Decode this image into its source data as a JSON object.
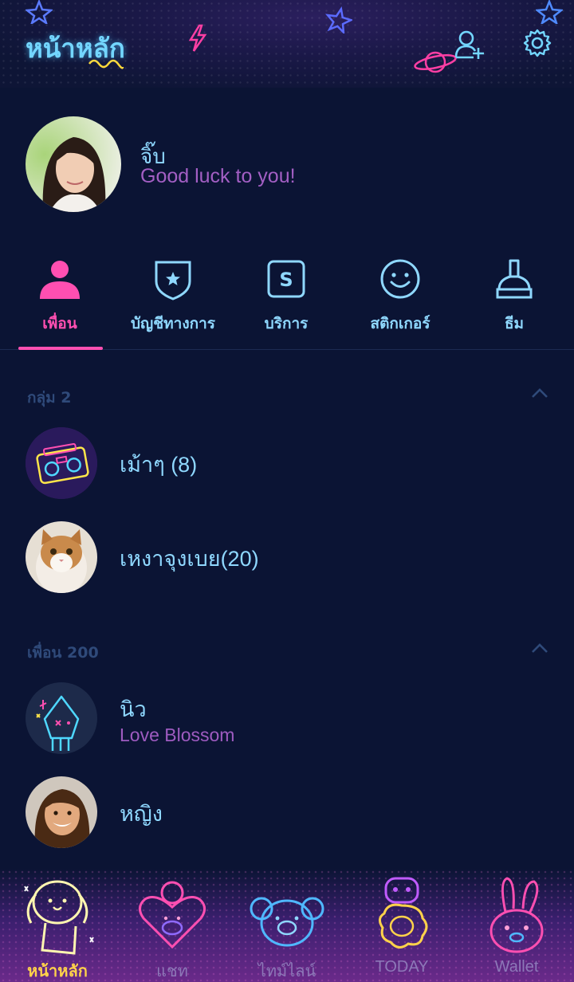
{
  "header": {
    "title": "หน้าหลัก"
  },
  "profile": {
    "name": "จิ๊บ",
    "status": "Good luck to you!"
  },
  "tabs": [
    {
      "label": "เพื่อน",
      "icon": "person-icon",
      "active": true
    },
    {
      "label": "บัญชีทางการ",
      "icon": "shield-star-icon",
      "active": false
    },
    {
      "label": "บริการ",
      "icon": "service-s-icon",
      "active": false
    },
    {
      "label": "สติกเกอร์",
      "icon": "smiley-icon",
      "active": false
    },
    {
      "label": "ธีม",
      "icon": "theme-brush-icon",
      "active": false
    }
  ],
  "groups": {
    "header": "กลุ่ม 2",
    "items": [
      {
        "name": "เม้าๆ (8)",
        "icon": "boombox-icon"
      },
      {
        "name": "เหงาจุงเบย(20)",
        "icon": "cat-photo"
      }
    ]
  },
  "friends": {
    "header": "เพื่อน 200",
    "items": [
      {
        "name": "นิว",
        "status": "Love Blossom"
      },
      {
        "name": "หญิง",
        "status": ""
      }
    ]
  },
  "bottom_nav": [
    {
      "label": "หน้าหลัก",
      "icon": "dog-character-icon",
      "active": true
    },
    {
      "label": "แชท",
      "icon": "heart-character-icon",
      "active": false
    },
    {
      "label": "ไทม์ไลน์",
      "icon": "koala-character-icon",
      "active": false
    },
    {
      "label": "TODAY",
      "icon": "sheep-character-icon",
      "active": false
    },
    {
      "label": "Wallet",
      "icon": "rabbit-character-icon",
      "active": false
    }
  ],
  "colors": {
    "background": "#0b1434",
    "accent_pink": "#ff4fb1",
    "text_cyan": "#8fd8ff",
    "status_purple": "#a35fc4",
    "active_nav": "#ffd24a"
  }
}
